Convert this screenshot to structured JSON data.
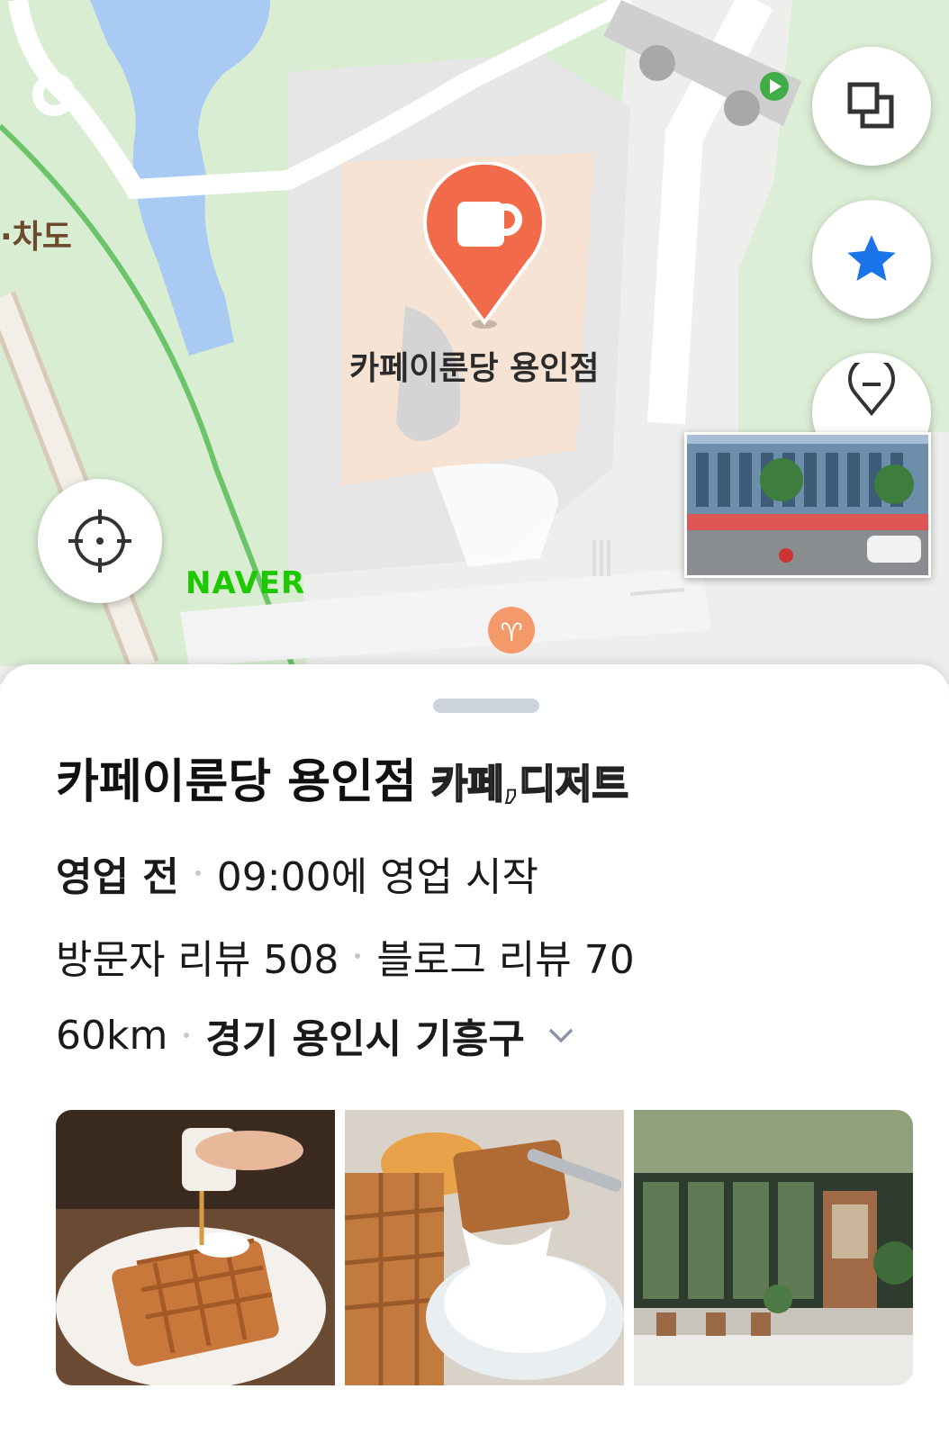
{
  "map": {
    "place_label": "카페이룬당 용인점",
    "road_label": "·차도",
    "naver_logo": "NAVER",
    "marker_icon": "coffee-cup-icon",
    "colors": {
      "marker": "#f16a4a",
      "water": "#a9cbf3",
      "park": "#d8edd2",
      "rail": "#6cc46a",
      "naver": "#1ec800"
    }
  },
  "controls": {
    "layers_icon": "layers-icon",
    "favorite_icon": "star-icon",
    "location_icon": "crosshair-icon",
    "star_color": "#1a73e8"
  },
  "place": {
    "name": "카페이룬당 용인점",
    "category": "카페,디저트",
    "status": "영업 전",
    "open_time": "09:00에 영업 시작",
    "visitor_reviews": "방문자 리뷰 508",
    "blog_reviews": "블로그 리뷰 70",
    "distance": "60km",
    "address": "경기 용인시 기흥구"
  }
}
